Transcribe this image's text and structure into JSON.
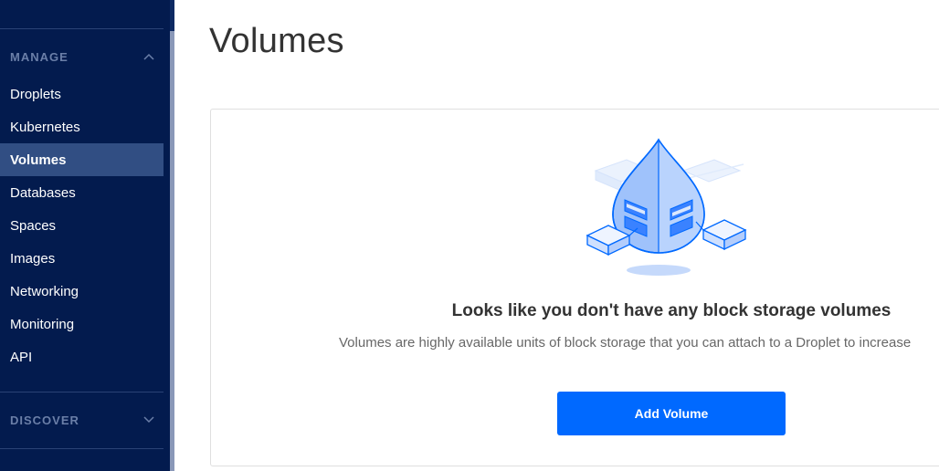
{
  "sidebar": {
    "sections": [
      {
        "label": "MANAGE",
        "chevron": "chevron-up-icon"
      },
      {
        "label": "DISCOVER",
        "chevron": "chevron-down-icon"
      }
    ],
    "items": [
      {
        "label": "Droplets"
      },
      {
        "label": "Kubernetes"
      },
      {
        "label": "Volumes",
        "active": true
      },
      {
        "label": "Databases"
      },
      {
        "label": "Spaces"
      },
      {
        "label": "Images"
      },
      {
        "label": "Networking"
      },
      {
        "label": "Monitoring"
      },
      {
        "label": "API"
      }
    ]
  },
  "main": {
    "title": "Volumes",
    "empty_state": {
      "illustration": "volume-droplet-illustration",
      "heading": "Looks like you don't have any block storage volumes",
      "body": "Volumes are highly available units of block storage that you can attach to a Droplet to increase",
      "button_label": "Add Volume"
    }
  },
  "colors": {
    "sidebar_bg": "#031b4e",
    "active_item_bg": "#314e83",
    "primary_button": "#0069ff"
  }
}
